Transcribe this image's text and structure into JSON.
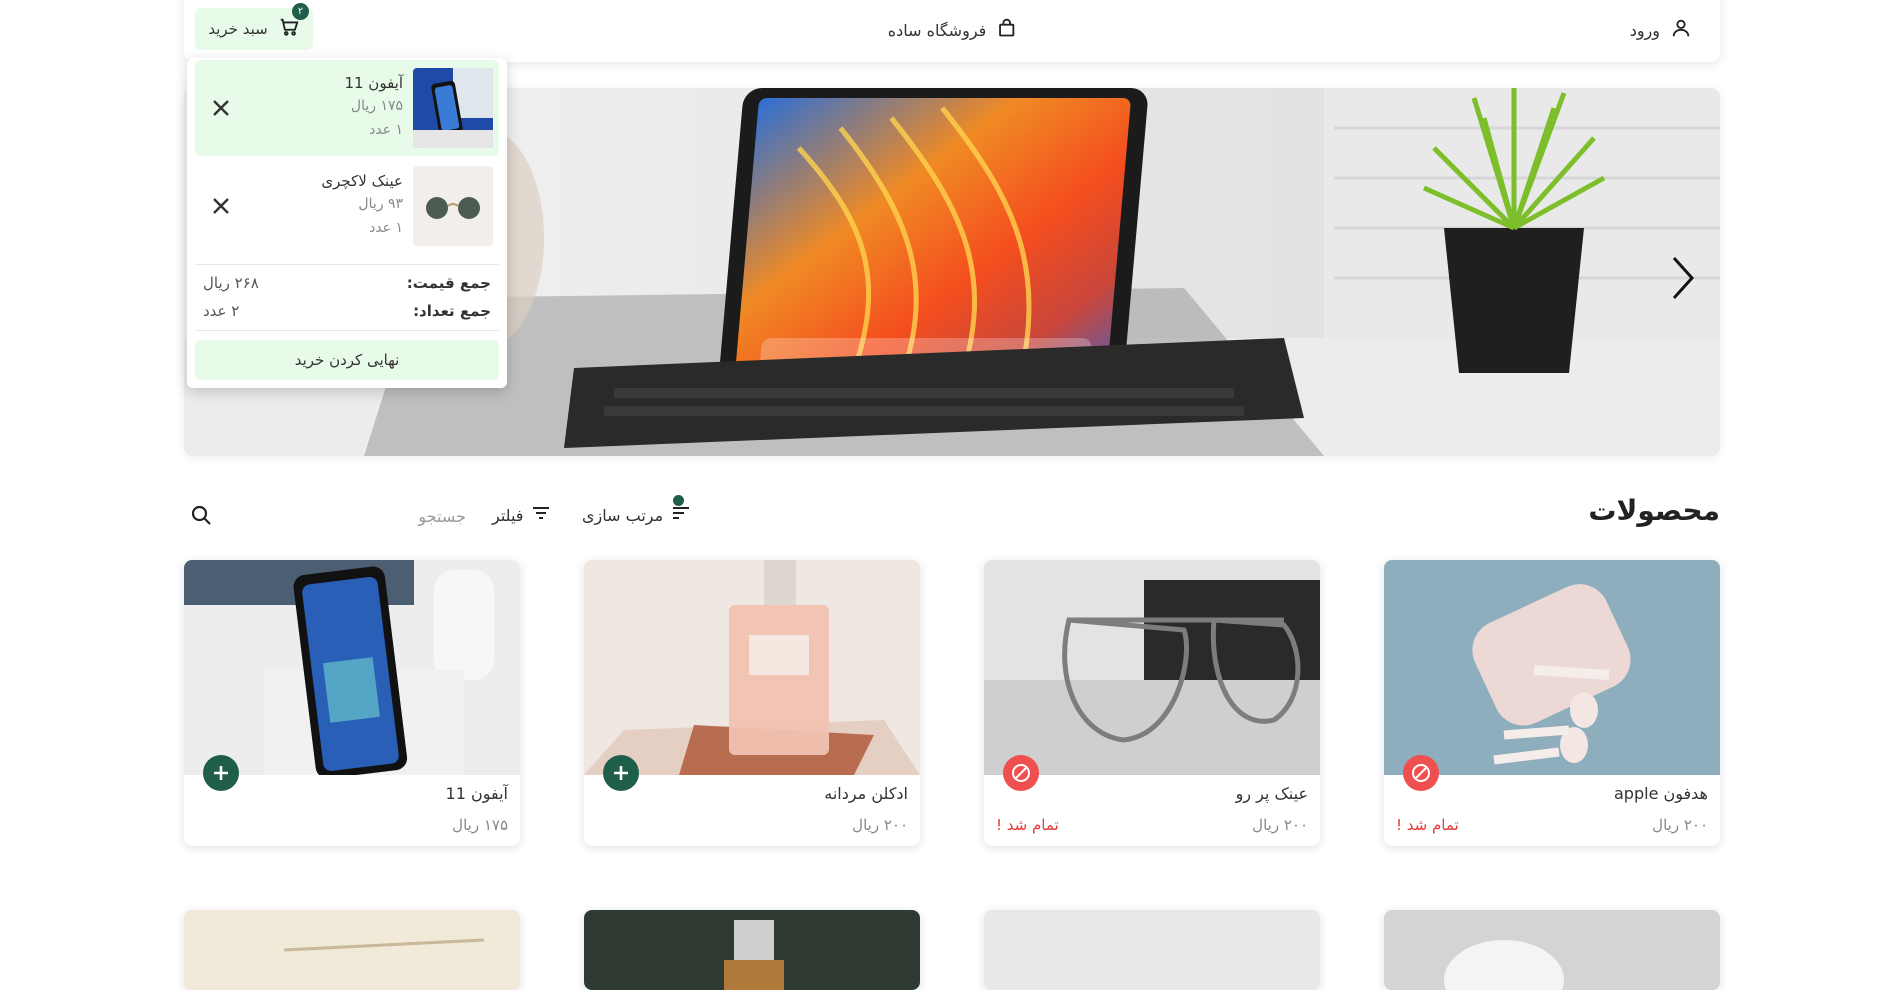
{
  "header": {
    "login_label": "ورود",
    "store_name": "فروشگاه ساده",
    "cart_label": "سبد خرید",
    "cart_count": "۲"
  },
  "cart": {
    "items": [
      {
        "name": "آیفون 11",
        "price": "۱۷۵ ریال",
        "qty": "۱ عدد"
      },
      {
        "name": "عینک لاکچری",
        "price": "۹۳ ریال",
        "qty": "۱ عدد"
      }
    ],
    "total_price_label": "جمع قیمت:",
    "total_price": "۲۶۸ ریال",
    "total_qty_label": "جمع تعداد:",
    "total_qty": "۲ عدد",
    "checkout_label": "نهایی کردن خرید"
  },
  "toolbar": {
    "title": "محصولات",
    "sort_label": "مرتب سازی",
    "filter_label": "فیلتر",
    "search_placeholder": "جستجو"
  },
  "products": [
    {
      "name": "هدفون apple",
      "price": "۲۰۰ ریال",
      "status": "تمام شد !"
    },
    {
      "name": "عینک پر رو",
      "price": "۲۰۰ ریال",
      "status": "تمام شد !"
    },
    {
      "name": "ادکلن مردانه",
      "price": "۲۰۰ ریال",
      "status": ""
    },
    {
      "name": "آیفون 11",
      "price": "۱۷۵ ریال",
      "status": ""
    }
  ],
  "colors": {
    "accent": "#1e5e4a",
    "light_green": "#e8fbe8",
    "danger": "#ef4f4f"
  }
}
